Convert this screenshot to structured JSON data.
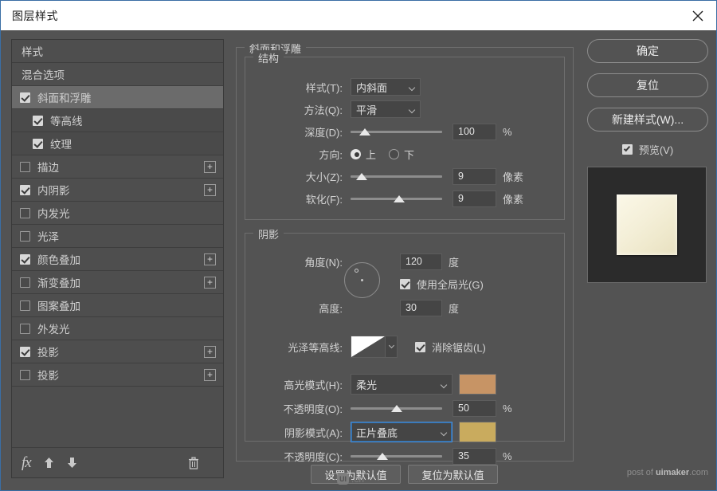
{
  "window": {
    "title": "图层样式",
    "close_label": "×"
  },
  "sidebar": {
    "items": [
      {
        "label": "样式",
        "checkbox": false,
        "checked": false,
        "plus": false,
        "selected": false,
        "sub": false
      },
      {
        "label": "混合选项",
        "checkbox": false,
        "checked": false,
        "plus": false,
        "selected": false,
        "sub": false
      },
      {
        "label": "斜面和浮雕",
        "checkbox": true,
        "checked": true,
        "plus": false,
        "selected": true,
        "sub": false
      },
      {
        "label": "等高线",
        "checkbox": true,
        "checked": true,
        "plus": false,
        "selected": false,
        "sub": true
      },
      {
        "label": "纹理",
        "checkbox": true,
        "checked": true,
        "plus": false,
        "selected": false,
        "sub": true
      },
      {
        "label": "描边",
        "checkbox": true,
        "checked": false,
        "plus": true,
        "selected": false,
        "sub": false
      },
      {
        "label": "内阴影",
        "checkbox": true,
        "checked": true,
        "plus": true,
        "selected": false,
        "sub": false
      },
      {
        "label": "内发光",
        "checkbox": true,
        "checked": false,
        "plus": false,
        "selected": false,
        "sub": false
      },
      {
        "label": "光泽",
        "checkbox": true,
        "checked": false,
        "plus": false,
        "selected": false,
        "sub": false
      },
      {
        "label": "颜色叠加",
        "checkbox": true,
        "checked": true,
        "plus": true,
        "selected": false,
        "sub": false
      },
      {
        "label": "渐变叠加",
        "checkbox": true,
        "checked": false,
        "plus": true,
        "selected": false,
        "sub": false
      },
      {
        "label": "图案叠加",
        "checkbox": true,
        "checked": false,
        "plus": false,
        "selected": false,
        "sub": false
      },
      {
        "label": "外发光",
        "checkbox": true,
        "checked": false,
        "plus": false,
        "selected": false,
        "sub": false
      },
      {
        "label": "投影",
        "checkbox": true,
        "checked": true,
        "plus": true,
        "selected": false,
        "sub": false
      },
      {
        "label": "投影",
        "checkbox": true,
        "checked": false,
        "plus": true,
        "selected": false,
        "sub": false
      }
    ],
    "footer": {
      "fx_label": "fx",
      "up_label": "↑",
      "down_label": "↓",
      "trash_label": "🗑"
    }
  },
  "main": {
    "group_title": "斜面和浮雕",
    "structure": {
      "title": "结构",
      "style": {
        "label": "样式(T):",
        "value": "内斜面"
      },
      "technique": {
        "label": "方法(Q):",
        "value": "平滑"
      },
      "depth": {
        "label": "深度(D):",
        "value": "100",
        "unit": "%",
        "percent": 16
      },
      "direction": {
        "label": "方向:",
        "up": "上",
        "down": "下",
        "selected": "上"
      },
      "size": {
        "label": "大小(Z):",
        "value": "9",
        "unit": "像素",
        "percent": 12
      },
      "soften": {
        "label": "软化(F):",
        "value": "9",
        "unit": "像素",
        "percent": 53
      }
    },
    "shading": {
      "title": "阴影",
      "angle": {
        "label": "角度(N):",
        "value": "120",
        "unit": "度"
      },
      "global_light": {
        "label": "使用全局光(G)",
        "checked": true
      },
      "altitude": {
        "label": "高度:",
        "value": "30",
        "unit": "度"
      },
      "gloss_contour": {
        "label": "光泽等高线:"
      },
      "anti_alias": {
        "label": "消除锯齿(L)",
        "checked": true
      },
      "highlight_mode": {
        "label": "高光模式(H):",
        "value": "柔光",
        "color": "#c79465"
      },
      "highlight_opacity": {
        "label": "不透明度(O):",
        "value": "50",
        "unit": "%",
        "percent": 50
      },
      "shadow_mode": {
        "label": "阴影模式(A):",
        "value": "正片叠底",
        "color": "#c9ab5e",
        "focused": true
      },
      "shadow_opacity": {
        "label": "不透明度(C):",
        "value": "35",
        "unit": "%",
        "percent": 35
      }
    },
    "footer": {
      "set_default": "设置为默认值",
      "reset_default": "复位为默认值"
    }
  },
  "right": {
    "ok": "确定",
    "reset": "复位",
    "new_style": "新建样式(W)...",
    "preview": {
      "label": "预览(V)",
      "checked": true
    }
  },
  "watermarks": {
    "bottom_right_prefix": "post of ",
    "bottom_right_brand": "uimaker",
    "bottom_right_suffix": ".com",
    "center": "UI.cn",
    "center_mark": "UI"
  },
  "colors": {
    "accent": "#4b8ed6",
    "panel": "#535353",
    "sidebar": "#4e4e4e",
    "highlight_swatch": "#c79465",
    "shadow_swatch": "#c9ab5e"
  }
}
